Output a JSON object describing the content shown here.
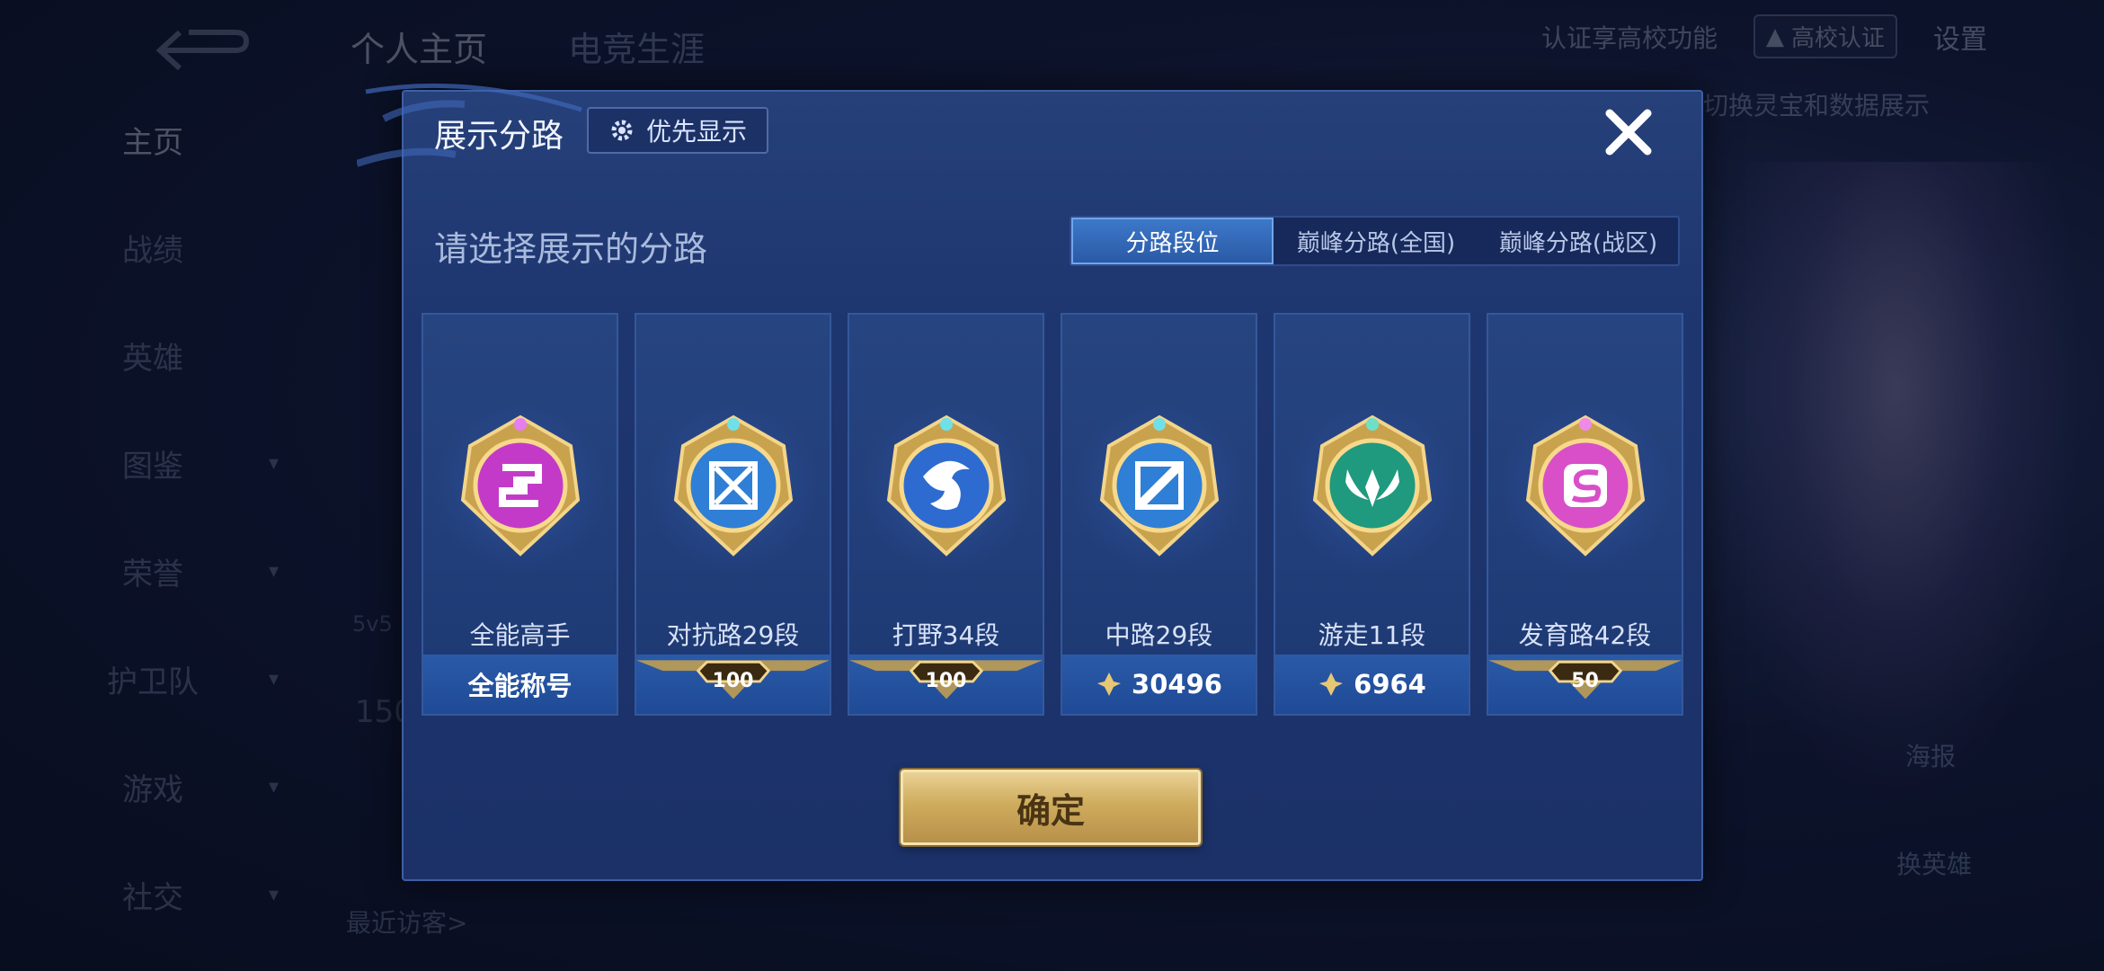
{
  "background": {
    "top_tabs": [
      "个人主页",
      "电竞生涯"
    ],
    "campus_text": "认证享高校功能",
    "campus_badge": "高校认证",
    "settings": "设置",
    "switch_hint": "切换灵宝和数据展示",
    "sidebar": [
      {
        "label": "主页",
        "chevron": false
      },
      {
        "label": "战绩",
        "chevron": false
      },
      {
        "label": "英雄",
        "chevron": false
      },
      {
        "label": "图鉴",
        "chevron": true
      },
      {
        "label": "荣誉",
        "chevron": true
      },
      {
        "label": "护卫队",
        "chevron": true
      },
      {
        "label": "游戏",
        "chevron": true
      },
      {
        "label": "社交",
        "chevron": true
      }
    ],
    "recent_visitors": "最近访客>",
    "mode_label": "5v5",
    "count_label": "150",
    "poster": "海报",
    "change_hero": "换英雄"
  },
  "modal": {
    "title": "展示分路",
    "priority_button": "优先显示",
    "section_title": "请选择展示的分路",
    "tabs": [
      "分路段位",
      "巅峰分路(全国)",
      "巅峰分路(战区)"
    ],
    "active_tab": 0,
    "confirm": "确定",
    "cards": [
      {
        "name": "全能高手",
        "foot_type": "text",
        "foot": "全能称号",
        "emblem_color": "#c43ac8",
        "emblem_icon": "allround-emblem-icon"
      },
      {
        "name": "对抗路29段",
        "foot_type": "stars",
        "foot": "100",
        "emblem_color": "#2f7fd6",
        "emblem_icon": "clash-lane-emblem-icon"
      },
      {
        "name": "打野34段",
        "foot_type": "stars",
        "foot": "100",
        "emblem_color": "#2d6bd0",
        "emblem_icon": "jungle-emblem-icon"
      },
      {
        "name": "中路29段",
        "foot_type": "points",
        "foot": "30496",
        "emblem_color": "#2f7fd6",
        "emblem_icon": "mid-lane-emblem-icon"
      },
      {
        "name": "游走11段",
        "foot_type": "points",
        "foot": "6964",
        "emblem_color": "#1f9a7e",
        "emblem_icon": "roam-emblem-icon"
      },
      {
        "name": "发育路42段",
        "foot_type": "stars",
        "foot": "50",
        "emblem_color": "#d84fc8",
        "emblem_icon": "farm-lane-emblem-icon"
      }
    ]
  },
  "colors": {
    "modal_bg": "#1e3670",
    "active_tab": "#3d78c9",
    "confirm_gold": "#cfac5d"
  }
}
